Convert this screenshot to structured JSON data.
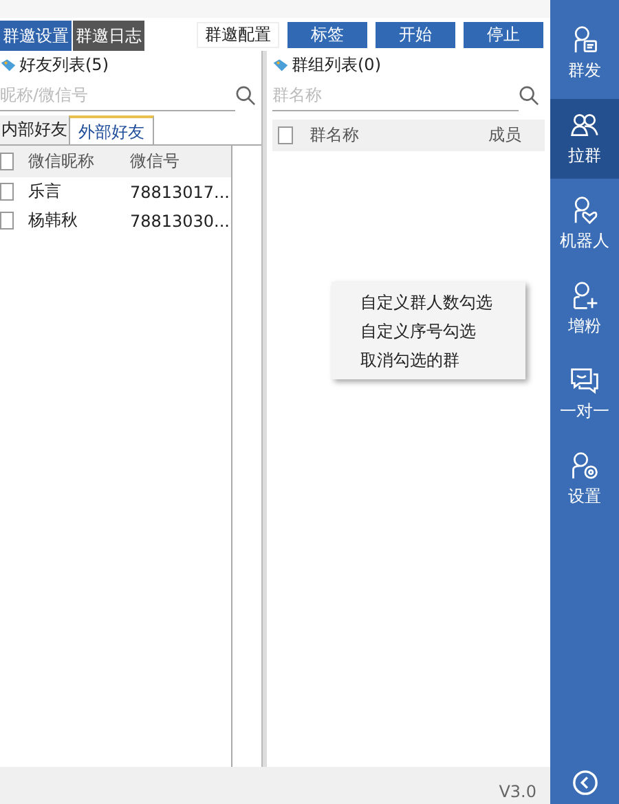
{
  "top_tabs": [
    {
      "label": "群邀设置",
      "selected": true
    },
    {
      "label": "群邀日志",
      "selected": false
    }
  ],
  "toolbar_buttons": [
    {
      "label": "群邀配置",
      "kind": "plain"
    },
    {
      "label": "标签",
      "kind": "primary"
    },
    {
      "label": "开始",
      "kind": "primary"
    },
    {
      "label": "停止",
      "kind": "primary"
    }
  ],
  "friends": {
    "title": "好友列表(5)",
    "search": {
      "placeholder": "昵称/微信号"
    },
    "tabs": [
      {
        "label": "内部好友",
        "selected": false
      },
      {
        "label": "外部好友",
        "selected": true
      }
    ],
    "columns": [
      "微信昵称",
      "微信号"
    ],
    "all_checked": false,
    "rows": [
      {
        "checked": false,
        "cells": [
          "乐言",
          "78813017..."
        ]
      },
      {
        "checked": false,
        "cells": [
          "杨韩秋",
          "78813030..."
        ]
      }
    ]
  },
  "groups": {
    "title": "群组列表(0)",
    "search": {
      "placeholder": "群名称"
    },
    "columns": [
      "群名称",
      "成员"
    ],
    "all_checked": false
  },
  "context_menu": [
    "自定义群人数勾选",
    "自定义序号勾选",
    "取消勾选的群"
  ],
  "status_bar": {
    "version": "V3.0"
  },
  "sidebar": {
    "items": [
      {
        "label": "群发",
        "kind": "broadcast",
        "selected": false
      },
      {
        "label": "拉群",
        "kind": "group",
        "selected": true
      },
      {
        "label": "机器人",
        "kind": "robot",
        "selected": false
      },
      {
        "label": "增粉",
        "kind": "add",
        "selected": false
      },
      {
        "label": "一对一",
        "kind": "chat",
        "selected": false
      },
      {
        "label": "设置",
        "kind": "settings",
        "selected": false
      }
    ]
  }
}
